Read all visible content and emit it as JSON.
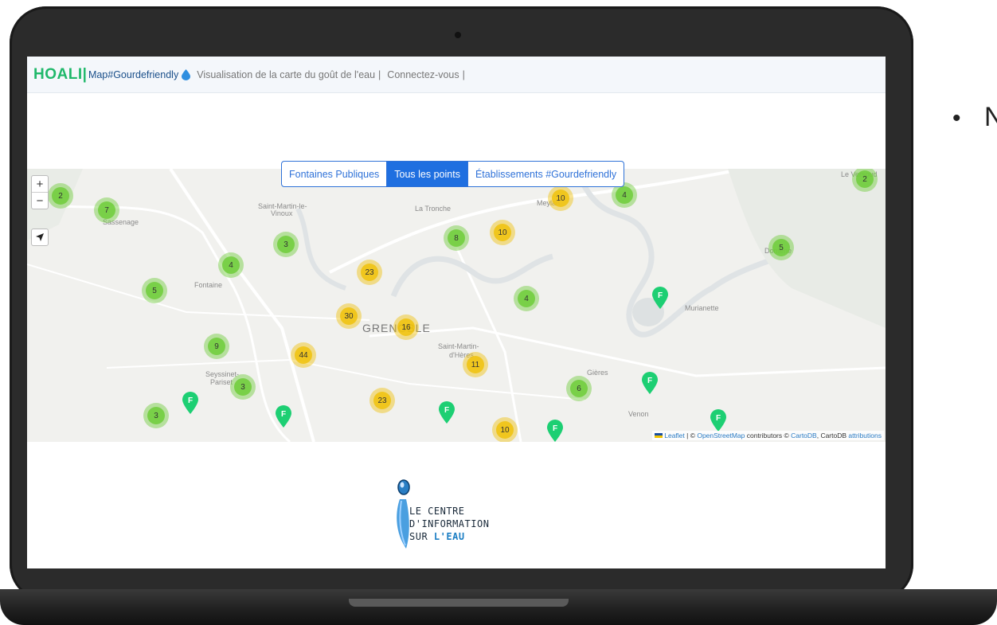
{
  "navbar": {
    "brand": "HOALI",
    "brand_bar": "|",
    "app_name": "Map#Gourdefriendly",
    "drop_icon": "water-drop-icon",
    "items": [
      "Visualisation de la carte du goût de l'eau",
      "Connectez-vous"
    ],
    "separator": "|"
  },
  "map": {
    "filter_tabs": [
      "Fontaines Publiques",
      "Tous les points",
      "Établissements #Gourdefriendly"
    ],
    "active_tab": "Tous les points",
    "zoom_in": "+",
    "zoom_out": "−",
    "locate_icon": "navigation-arrow-icon",
    "places": [
      "Saint-Martin-le-",
      "Vinoux",
      "La Tronche",
      "Meylan",
      "Sassenage",
      "Fontaine",
      "GRENOBLE",
      "Saint-Martin-",
      "d'Hères",
      "Seyssinet-",
      "Pariset",
      "Gières",
      "Venon",
      "Murianette",
      "Le Versoud",
      "Domène"
    ],
    "clusters": [
      {
        "count": "2",
        "level": "green"
      },
      {
        "count": "7",
        "level": "green"
      },
      {
        "count": "3",
        "level": "green"
      },
      {
        "count": "4",
        "level": "green"
      },
      {
        "count": "5",
        "level": "green"
      },
      {
        "count": "9",
        "level": "green"
      },
      {
        "count": "3",
        "level": "green"
      },
      {
        "count": "3",
        "level": "green"
      },
      {
        "count": "23",
        "level": "yellow"
      },
      {
        "count": "30",
        "level": "yellow"
      },
      {
        "count": "16",
        "level": "yellow"
      },
      {
        "count": "44",
        "level": "yellow"
      },
      {
        "count": "23",
        "level": "yellow"
      },
      {
        "count": "8",
        "level": "green"
      },
      {
        "count": "10",
        "level": "yellow"
      },
      {
        "count": "10",
        "level": "yellow"
      },
      {
        "count": "4",
        "level": "green"
      },
      {
        "count": "4",
        "level": "green"
      },
      {
        "count": "11",
        "level": "yellow"
      },
      {
        "count": "6",
        "level": "green"
      },
      {
        "count": "10",
        "level": "yellow"
      },
      {
        "count": "5",
        "level": "green"
      },
      {
        "count": "2",
        "level": "green"
      }
    ],
    "pin_label": "F",
    "colors": {
      "cluster_small": "#6ecc39",
      "cluster_medium": "#f0c20c",
      "pin": "#1dcf73",
      "tab_active": "#1f6fe0"
    },
    "attribution": {
      "leaflet": "Leaflet",
      "sep1": " | © ",
      "osm": "OpenStreetMap",
      "mid": " contributors © ",
      "carto": "CartoDB",
      "mid2": ", CartoDB ",
      "attr": "attributions"
    }
  },
  "footer_logo": {
    "line1": "LE CENTRE",
    "line2": "D'INFORMATION",
    "line3_a": "SUR",
    "line3_b": "L'EAU"
  },
  "slide": {
    "bullet": "•",
    "cut_text": "N"
  }
}
